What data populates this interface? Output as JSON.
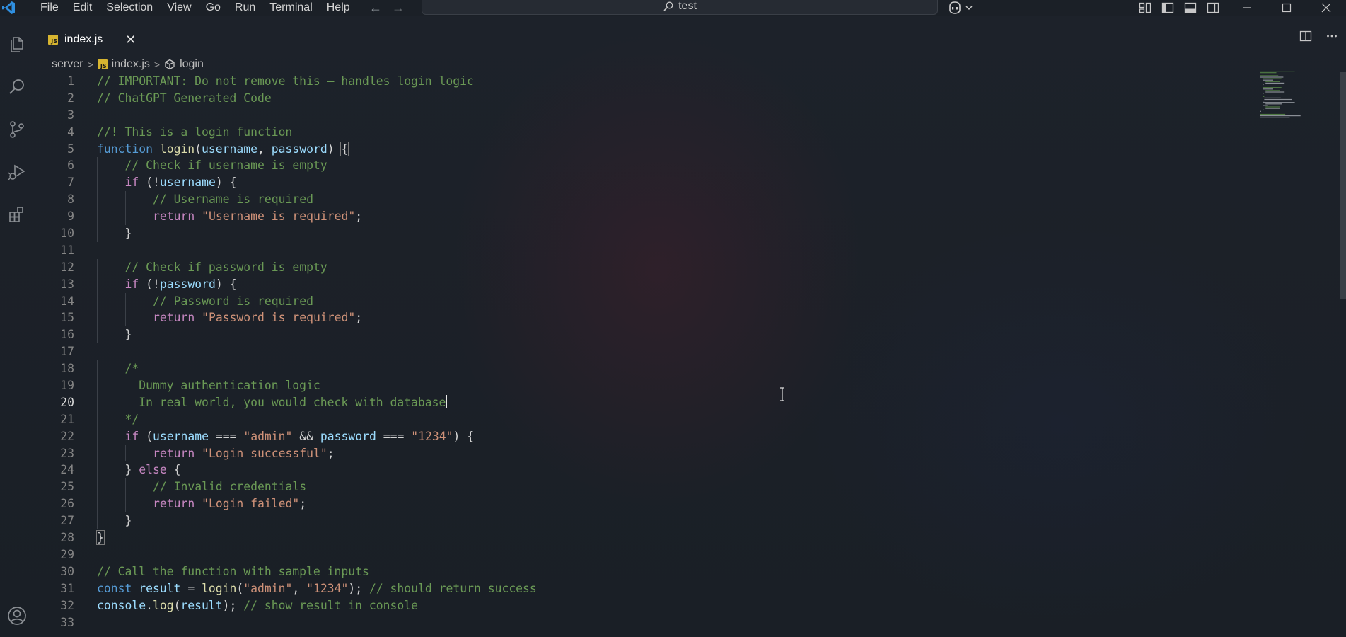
{
  "titlebar": {
    "menu": [
      "File",
      "Edit",
      "Selection",
      "View",
      "Go",
      "Run",
      "Terminal",
      "Help"
    ],
    "search_text": "test",
    "window_controls": [
      "minimize-icon",
      "maximize-icon",
      "close-icon"
    ],
    "layout_icons": [
      "customize-layout-icon",
      "toggle-primary-sidebar-icon",
      "toggle-panel-icon",
      "toggle-secondary-sidebar-icon"
    ]
  },
  "activity_bar": {
    "items": [
      "explorer-icon",
      "search-icon",
      "source-control-icon",
      "run-debug-icon",
      "extensions-icon"
    ],
    "bottom": [
      "accounts-icon"
    ]
  },
  "tab": {
    "badge": "JS",
    "name": "index.js"
  },
  "breadcrumb": {
    "folder": "server",
    "file": "index.js",
    "symbol": "login"
  },
  "editor": {
    "active_line": 20,
    "lines": [
      "// IMPORTANT: Do not remove this — handles login logic",
      "// ChatGPT Generated Code",
      "",
      "//! This is a login function",
      "function login(username, password) {",
      "    // Check if username is empty",
      "    if (!username) {",
      "        // Username is required",
      "        return \"Username is required\";",
      "    }",
      "",
      "    // Check if password is empty",
      "    if (!password) {",
      "        // Password is required",
      "        return \"Password is required\";",
      "    }",
      "",
      "    /*",
      "      Dummy authentication logic",
      "      In real world, you would check with database",
      "    */",
      "    if (username === \"admin\" && password === \"1234\") {",
      "        return \"Login successful\";",
      "    } else {",
      "        // Invalid credentials",
      "        return \"Login failed\";",
      "    }",
      "}",
      "",
      "// Call the function with sample inputs",
      "const result = login(\"admin\", \"1234\"); // should return success",
      "console.log(result); // show result in console",
      ""
    ]
  }
}
